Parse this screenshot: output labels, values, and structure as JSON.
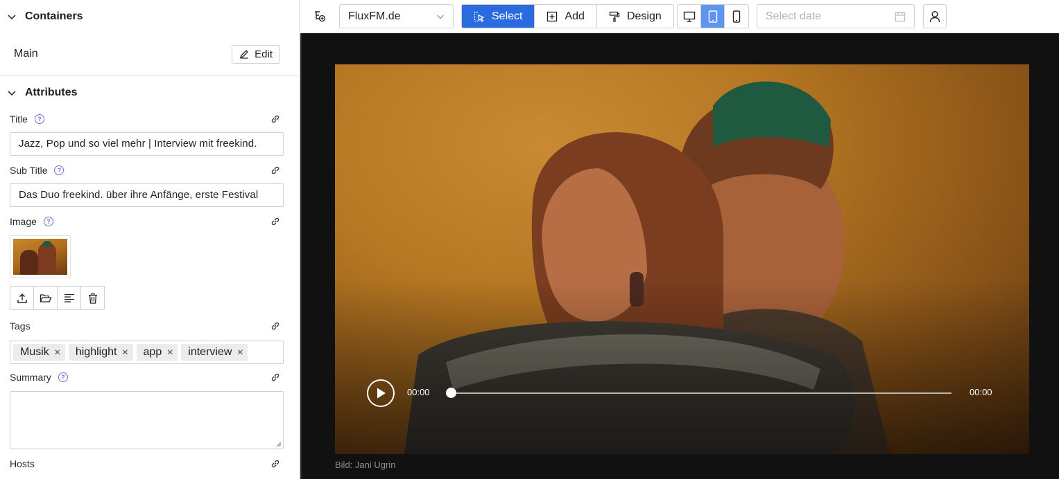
{
  "sidebar": {
    "containers_title": "Containers",
    "main_label": "Main",
    "edit_label": "Edit",
    "attributes_title": "Attributes",
    "title_label": "Title",
    "title_value": "Jazz, Pop und so viel mehr | Interview mit freekind.",
    "subtitle_label": "Sub Title",
    "subtitle_value": "Das Duo freekind. über ihre Anfänge, erste Festival",
    "image_label": "Image",
    "tags_label": "Tags",
    "tags": [
      "Musik",
      "highlight",
      "app",
      "interview"
    ],
    "summary_label": "Summary",
    "summary_value": "",
    "hosts_label": "Hosts"
  },
  "toolbar": {
    "site": "FluxFM.de",
    "modes": [
      "Select",
      "Add",
      "Design"
    ],
    "active_mode": "Select",
    "devices": [
      "desktop",
      "tablet",
      "mobile"
    ],
    "active_device": "tablet",
    "date_placeholder": "Select date"
  },
  "preview": {
    "caption": "Bild: Jani Ugrin",
    "time_current": "00:00",
    "time_total": "00:00",
    "progress": 0
  },
  "colors": {
    "accent": "#2b6be0",
    "device_active": "#5d95f0",
    "help_icon": "#8a63d2",
    "preview_bg": "#111111"
  }
}
